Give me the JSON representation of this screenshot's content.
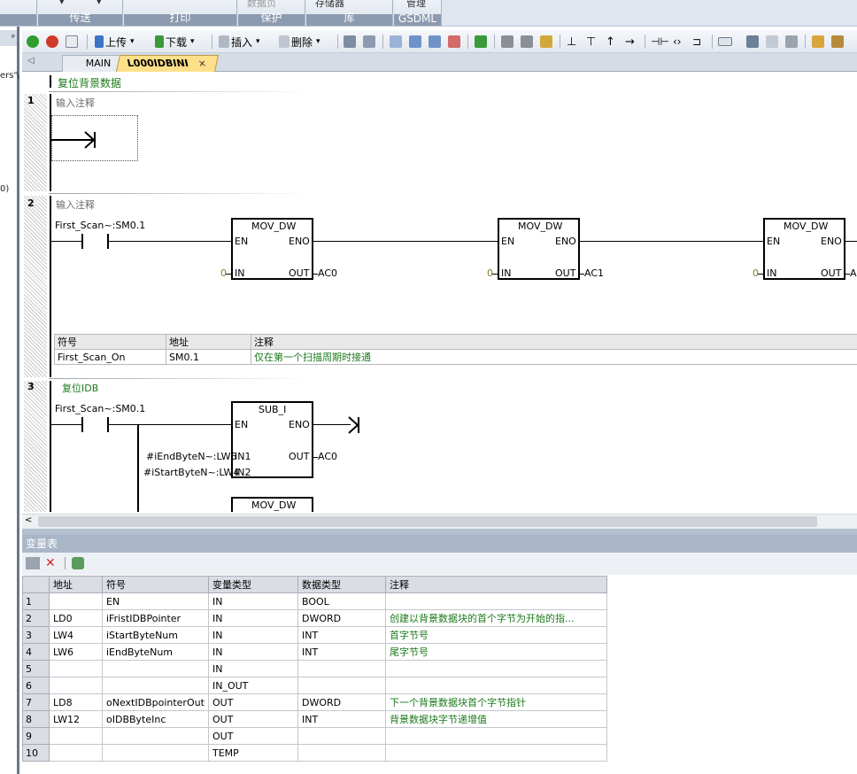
{
  "ribbon": {
    "groups": [
      {
        "label": "传送",
        "item": "▾"
      },
      {
        "label": "打印",
        "item": ""
      },
      {
        "label": "保护",
        "item": "数据页"
      },
      {
        "label": "库",
        "item": "存储器"
      },
      {
        "label": "GSDML",
        "item": "管理"
      }
    ]
  },
  "leftstrip": {
    "pin": "ᵖ",
    "frag1": "ers'\\",
    "frag2": "0)"
  },
  "toolbar": {
    "upload_label": "上传",
    "download_label": "下载",
    "insert_label": "插入",
    "delete_label": "删除"
  },
  "tabs": [
    {
      "label": "MAIN"
    },
    {
      "label": "L000IDBINI",
      "close": "×"
    }
  ],
  "editor": {
    "title_comment": "复位背景数据",
    "networks": [
      {
        "number": "1",
        "comment": "输入注释"
      },
      {
        "number": "2",
        "comment": "输入注释",
        "contact": "First_Scan~:SM0.1",
        "boxes": [
          {
            "name": "MOV_DW",
            "en": "EN",
            "eno": "ENO",
            "in": "IN",
            "out": "OUT",
            "in_val": "0",
            "out_val": "AC0"
          },
          {
            "name": "MOV_DW",
            "en": "EN",
            "eno": "ENO",
            "in": "IN",
            "out": "OUT",
            "in_val": "0",
            "out_val": "AC1"
          },
          {
            "name": "MOV_DW",
            "en": "EN",
            "eno": "ENO",
            "in": "IN",
            "out": "OUT",
            "in_val": "0",
            "out_val": "A"
          }
        ],
        "symbol_table": {
          "headers": [
            "符号",
            "地址",
            "注释"
          ],
          "row": [
            "First_Scan_On",
            "SM0.1",
            "仅在第一个扫描周期时接通"
          ]
        }
      },
      {
        "number": "3",
        "comment": "复位IDB",
        "contact": "First_Scan~:SM0.1",
        "sub": {
          "name": "SUB_I",
          "en": "EN",
          "eno": "ENO",
          "in1": "IN1",
          "in2": "IN2",
          "out": "OUT",
          "in1_val": "#iEndByteN~:LW6",
          "in2_val": "#iStartByteN~:LW4",
          "out_val": "AC0"
        },
        "next_box": "MOV_DW"
      }
    ]
  },
  "scroll": {
    "left_arrow": "<"
  },
  "var_table": {
    "title": "变量表",
    "headers": [
      "",
      "地址",
      "符号",
      "变量类型",
      "数据类型",
      "注释"
    ],
    "rows": [
      [
        "1",
        "",
        "EN",
        "IN",
        "BOOL",
        ""
      ],
      [
        "2",
        "LD0",
        "iFristIDBPointer",
        "IN",
        "DWORD",
        "创建以背景数据块的首个字节为开始的指..."
      ],
      [
        "3",
        "LW4",
        "iStartByteNum",
        "IN",
        "INT",
        "首字节号"
      ],
      [
        "4",
        "LW6",
        "iEndByteNum",
        "IN",
        "INT",
        "尾字节号"
      ],
      [
        "5",
        "",
        "",
        "IN",
        "",
        ""
      ],
      [
        "6",
        "",
        "",
        "IN_OUT",
        "",
        ""
      ],
      [
        "7",
        "LD8",
        "oNextIDBpointerOut",
        "OUT",
        "DWORD",
        "下一个背景数据块首个字节指针"
      ],
      [
        "8",
        "LW12",
        "oIDBByteInc",
        "OUT",
        "INT",
        "背景数据块字节递增值"
      ],
      [
        "9",
        "",
        "",
        "OUT",
        "",
        ""
      ],
      [
        "10",
        "",
        "",
        "TEMP",
        "",
        ""
      ]
    ]
  },
  "colors": {
    "accent_green": "#1c7a1c",
    "tab_active": "#ffe08a",
    "panel_title": "#a9b6c8"
  }
}
